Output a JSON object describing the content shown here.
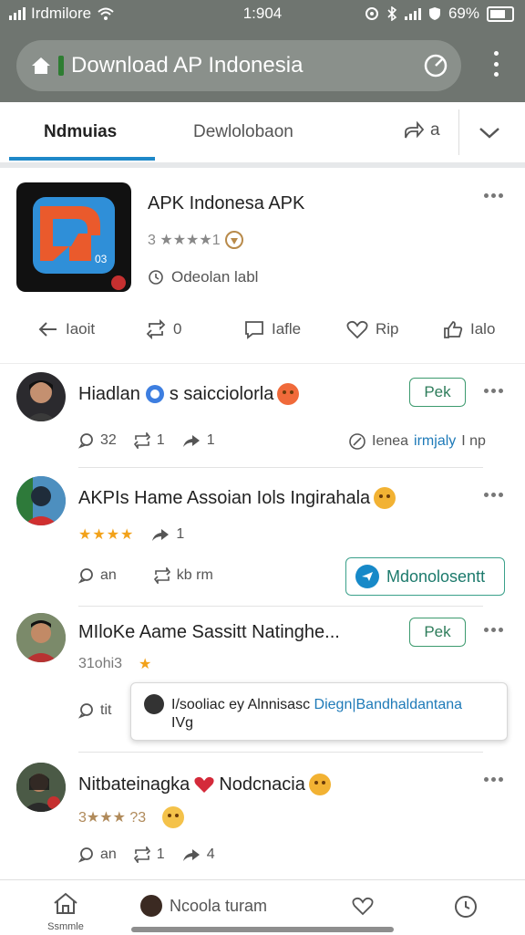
{
  "status_bar": {
    "carrier": "Irdmilore",
    "time": "1:904",
    "battery": "69%"
  },
  "browser": {
    "url_title": "Download AP Indonesia"
  },
  "tabs": {
    "tab1": "Ndmuias",
    "tab2": "Dewlolobaon",
    "tab3": "a"
  },
  "app": {
    "title": "APK Indonesa APK",
    "rating_text": "3 ★★★★1",
    "status": "Odeolan labl",
    "actions": [
      "Iaoit",
      "0",
      "Iafle",
      "Rip",
      "Ialo"
    ]
  },
  "posts": [
    {
      "title_a": "Hiadlan",
      "title_b": "s saicciolorla",
      "button": "Pek",
      "stats": [
        "32",
        "1",
        "1"
      ],
      "meta": "Ienea",
      "meta_link": "irmjaly",
      "meta_tail": "I np"
    },
    {
      "title": "AKPIs Hame Assoian Iols Ingirahala",
      "stars": "★★★★",
      "share_count": "1",
      "stats": [
        "an",
        "kb rm"
      ],
      "badge": "Mdonolosentt"
    },
    {
      "title": "MIloKe Aame Sassitt Natinghe...",
      "button": "Pek",
      "rating_prefix": "31ohi3",
      "stats": [
        "tit"
      ],
      "popup_text": "I/sooliac ey Alnnisasc",
      "popup_link": "Diegn|Bandhaldantana",
      "popup_tail": "IVg"
    },
    {
      "title_a": "Nitbateinagka",
      "title_b": "Nodcnacia",
      "rating_prefix": "3★★★ ?3",
      "stats": [
        "an",
        "1",
        "4"
      ]
    }
  ],
  "bottom_nav": {
    "home_label": "Ssmmle",
    "user_label": "Ncoola turam"
  }
}
